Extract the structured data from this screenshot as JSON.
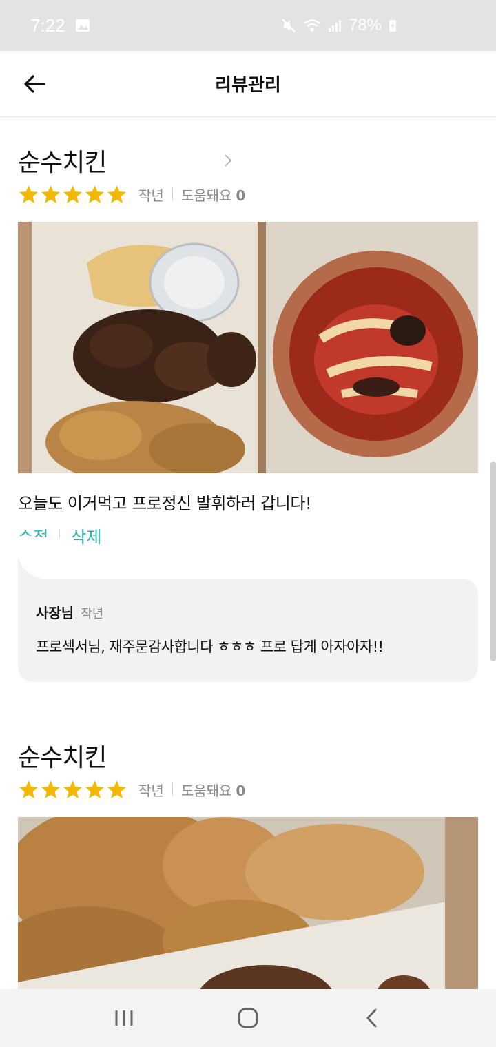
{
  "status_bar": {
    "time": "7:22",
    "battery": "78%",
    "icons": [
      "image-icon",
      "mute-icon",
      "wifi-icon",
      "signal-icon",
      "battery-charging-icon"
    ]
  },
  "app_bar": {
    "title": "리뷰관리",
    "back_icon": "back-arrow-icon"
  },
  "reviews": [
    {
      "shop_name": "순수치킨",
      "rating": 5,
      "date": "작년",
      "helpful_label": "도움돼요",
      "helpful_count": "0",
      "text": "오늘도 이거먹고 프로정신 발휘하러 갑니다!",
      "edit_label": "수정",
      "delete_label": "삭제",
      "reply": {
        "author": "사장님",
        "date": "작년",
        "text": "프로섹서님, 재주문감사합니다 ㅎㅎㅎ 프로 답게 아자아자!!"
      }
    },
    {
      "shop_name": "순수치킨",
      "rating": 5,
      "date": "작년",
      "helpful_label": "도움돼요",
      "helpful_count": "0"
    }
  ],
  "colors": {
    "accent": "#2ab5b7",
    "star": "#f5b800",
    "meta": "#8a8a8a",
    "reply_bg": "#f2f2f2"
  },
  "nav_bar": {
    "icons": [
      "recent-apps-icon",
      "home-icon",
      "back-icon"
    ]
  }
}
